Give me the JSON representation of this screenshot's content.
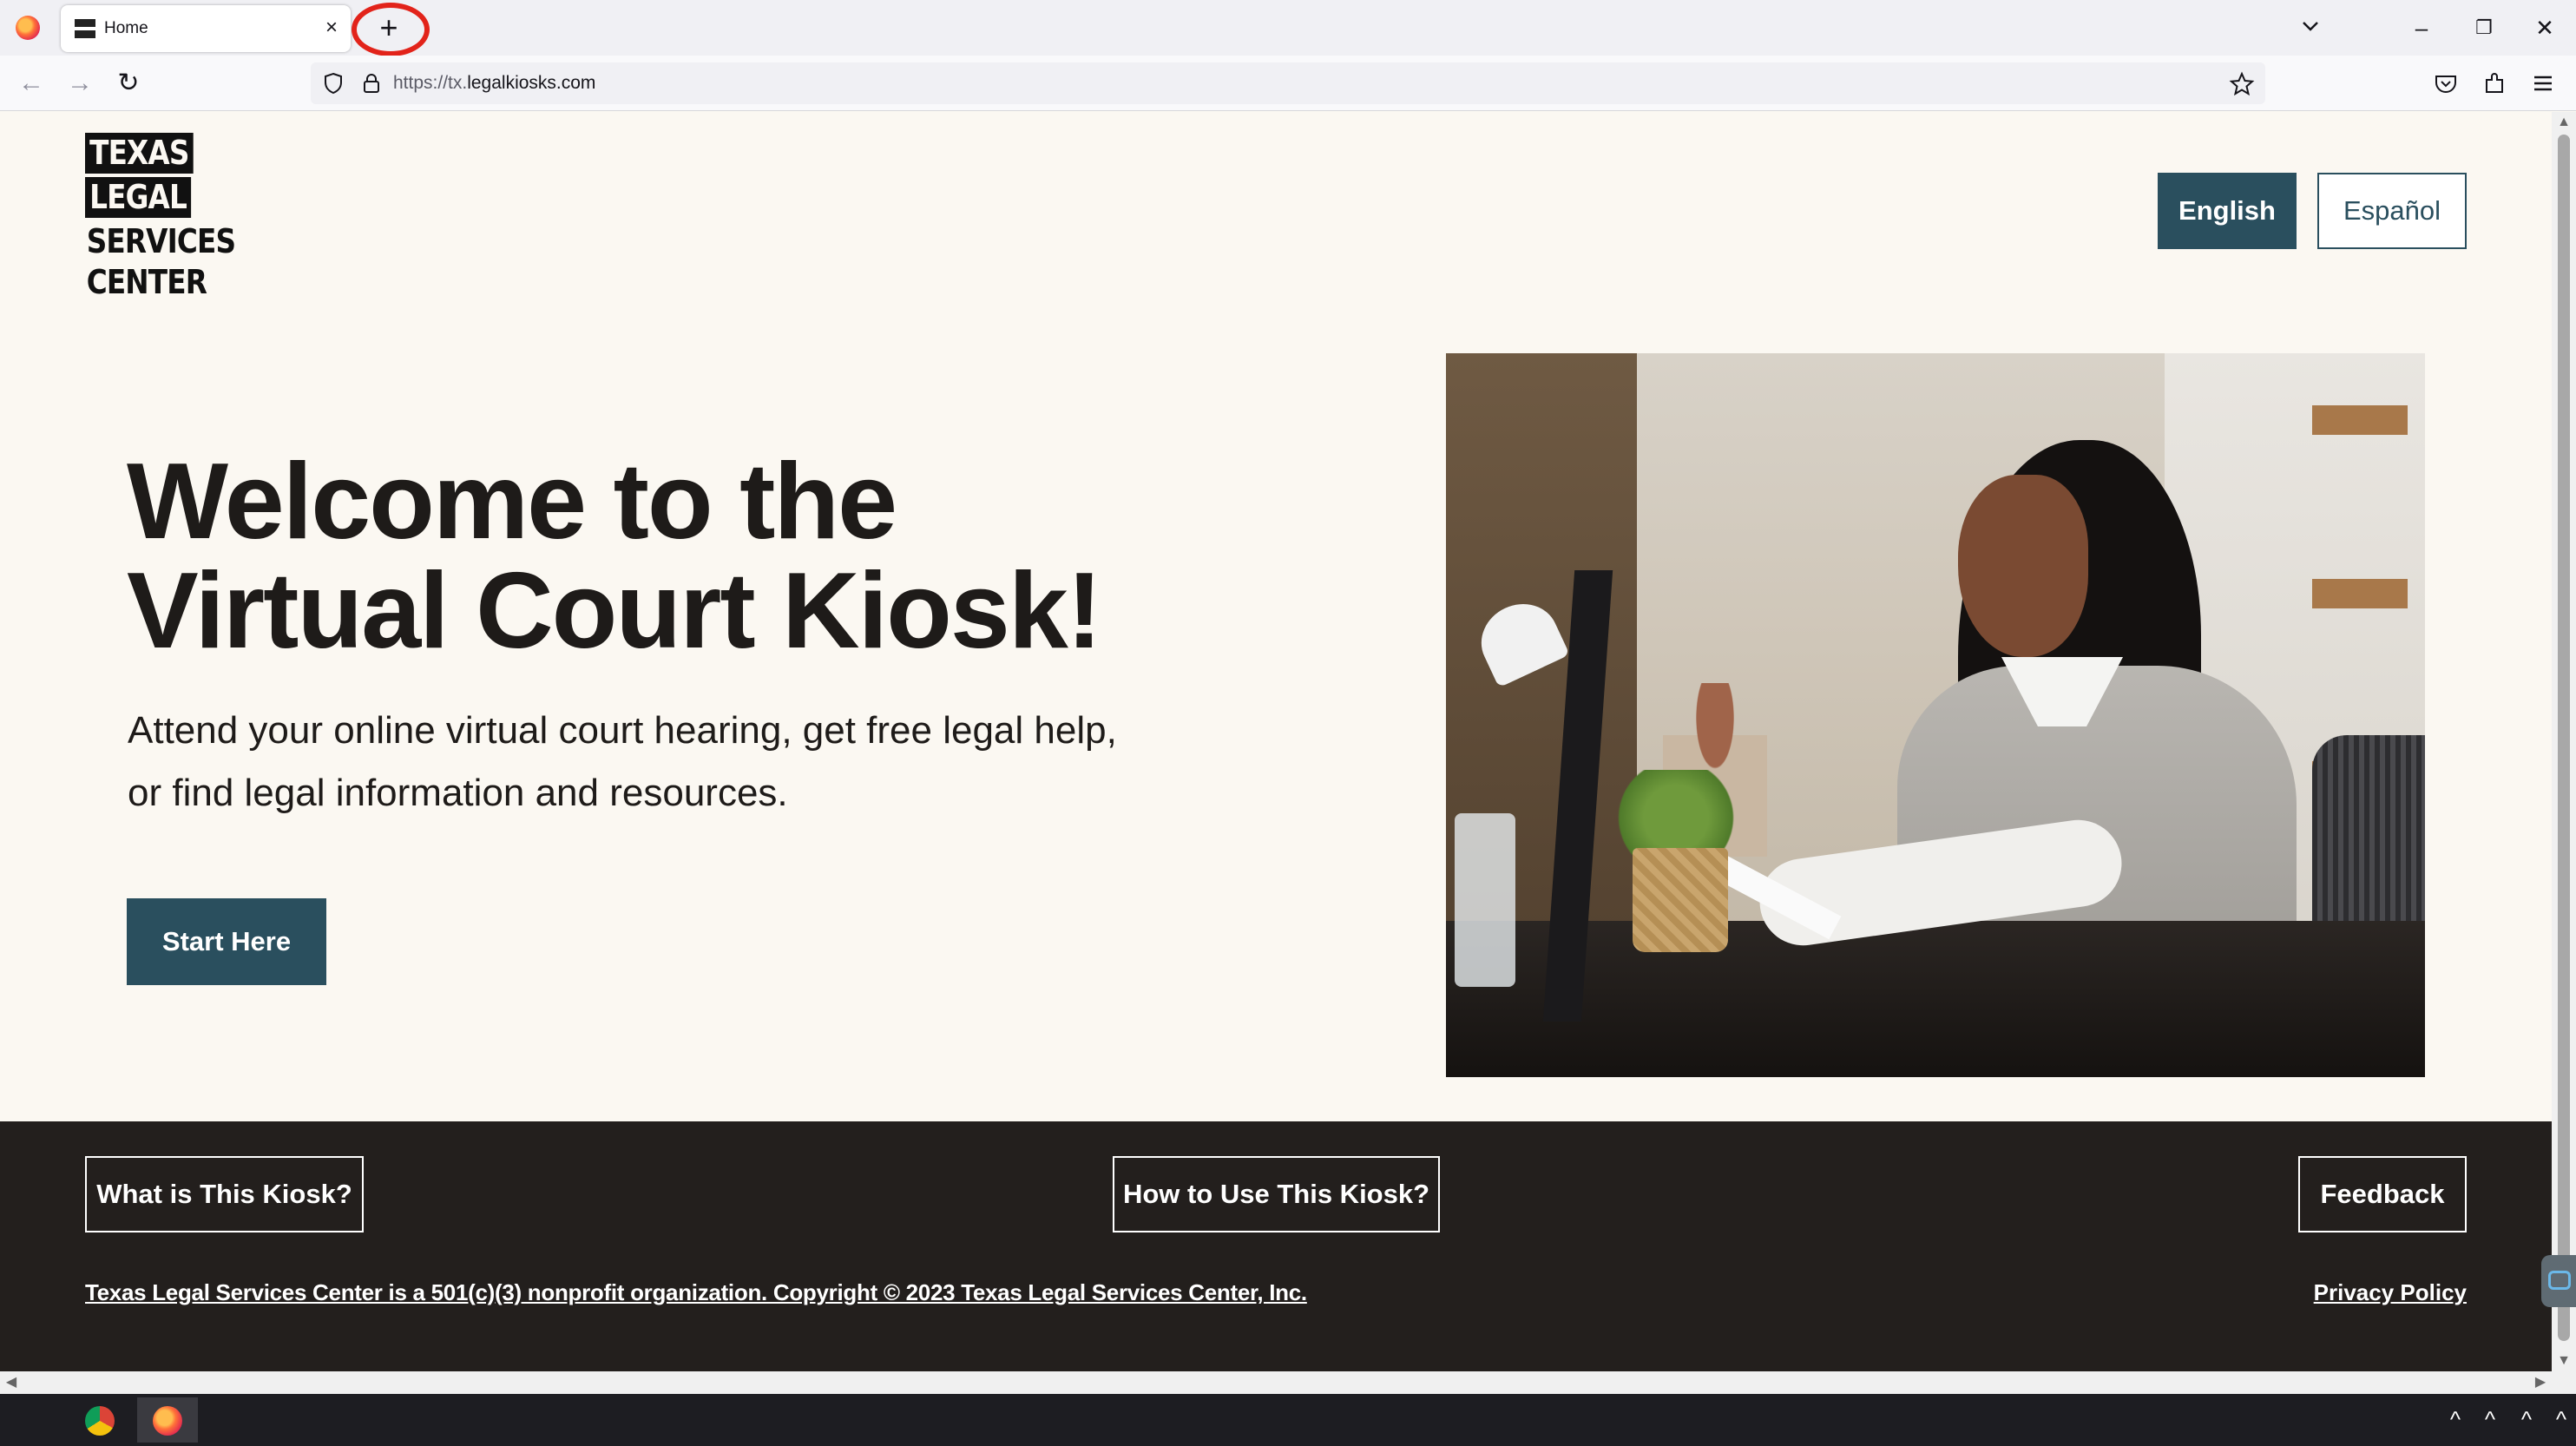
{
  "browser": {
    "tab_title": "Home",
    "tab_close_glyph": "×",
    "new_tab_glyph": "+",
    "url_prefix": "https://tx.",
    "url_domain": "legalkiosks.com",
    "window_controls": [
      "–",
      "❐",
      "✕"
    ],
    "nav_glyphs": {
      "back": "←",
      "forward": "→",
      "reload": "↻"
    }
  },
  "site": {
    "logo_lines": [
      "TEXAS",
      "LEGAL",
      "SERVICES",
      "CENTER"
    ],
    "lang_english": "English",
    "lang_spanish": "Español",
    "hero_title_line1": "Welcome to the",
    "hero_title_line2": "Virtual Court Kiosk!",
    "hero_sub_line1": "Attend your online virtual court hearing, get free legal help,",
    "hero_sub_line2": "or find legal information and resources.",
    "start_button": "Start Here"
  },
  "footer": {
    "what_button": "What is This Kiosk?",
    "how_button": "How to Use This Kiosk?",
    "feedback_button": "Feedback",
    "copyright": "Texas Legal Services Center is a 501(c)(3) nonprofit organization. Copyright © 2023 Texas Legal Services Center, Inc.",
    "privacy": "Privacy Policy"
  },
  "scroll_glyphs": {
    "up": "▲",
    "down": "▼",
    "left": "◀",
    "right": "▶"
  },
  "taskbar_chevrons": [
    "^",
    "^",
    "^",
    "^"
  ],
  "colors": {
    "accent": "#2a4f5e",
    "page_bg": "#fbf8f2",
    "footer_bg": "#231f1d",
    "highlight": "#e2231a"
  }
}
